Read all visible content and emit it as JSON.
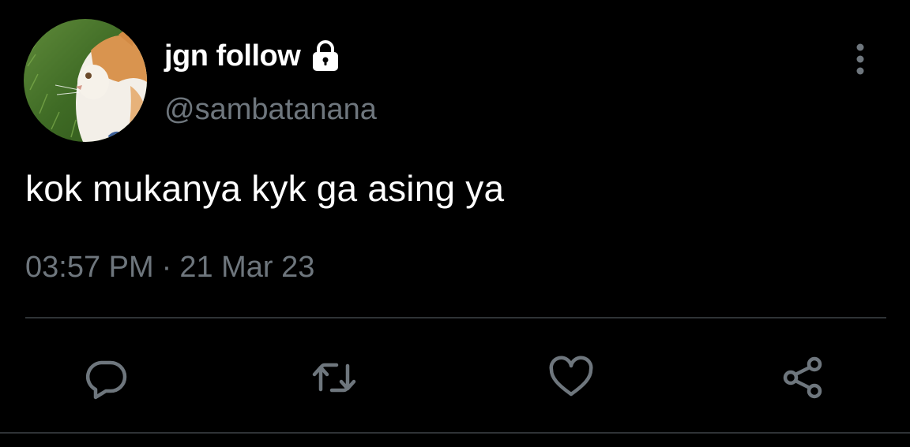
{
  "tweet": {
    "display_name": "jgn follow",
    "handle": "@sambatanana",
    "text": "kok mukanya kyk ga asing ya",
    "time": "03:57 PM",
    "separator": "·",
    "date": "21 Mar 23"
  },
  "icons": {
    "lock": "lock-icon",
    "more": "vertical-dots-icon",
    "reply": "comment-icon",
    "retweet": "retweet-icon",
    "like": "heart-icon",
    "share": "share-icon"
  },
  "colors": {
    "background": "#000000",
    "text_primary": "#ffffff",
    "text_secondary": "#6e767d",
    "divider": "#2f3336"
  }
}
